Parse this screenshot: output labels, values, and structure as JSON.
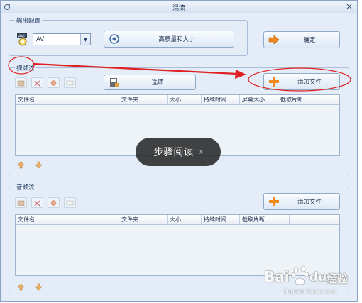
{
  "window": {
    "title": "混流",
    "close_glyph": "×"
  },
  "output": {
    "group_label": "输出配置",
    "format_value": "AVI",
    "quality_button": "高质量和大小",
    "confirm_button": "确定"
  },
  "video": {
    "group_label": "视频流",
    "options_button": "选项",
    "add_file_button": "添加文件",
    "columns": [
      "文件名",
      "文件夹",
      "大小",
      "持续时间",
      "屏幕大小",
      "截取片断"
    ]
  },
  "audio": {
    "group_label": "音频流",
    "add_file_button": "添加文件",
    "columns": [
      "文件名",
      "文件夹",
      "大小",
      "持续时间",
      "截取片断",
      ""
    ]
  },
  "overlay": {
    "label": "步骤阅读",
    "chevron": "›"
  },
  "watermark": {
    "brand": "Bai",
    "brand2": "du",
    "suffix": "经验",
    "url": "jingyan.baidu.com"
  },
  "colors": {
    "annotation": "#e02020",
    "accent_orange": "#f08a1c"
  }
}
